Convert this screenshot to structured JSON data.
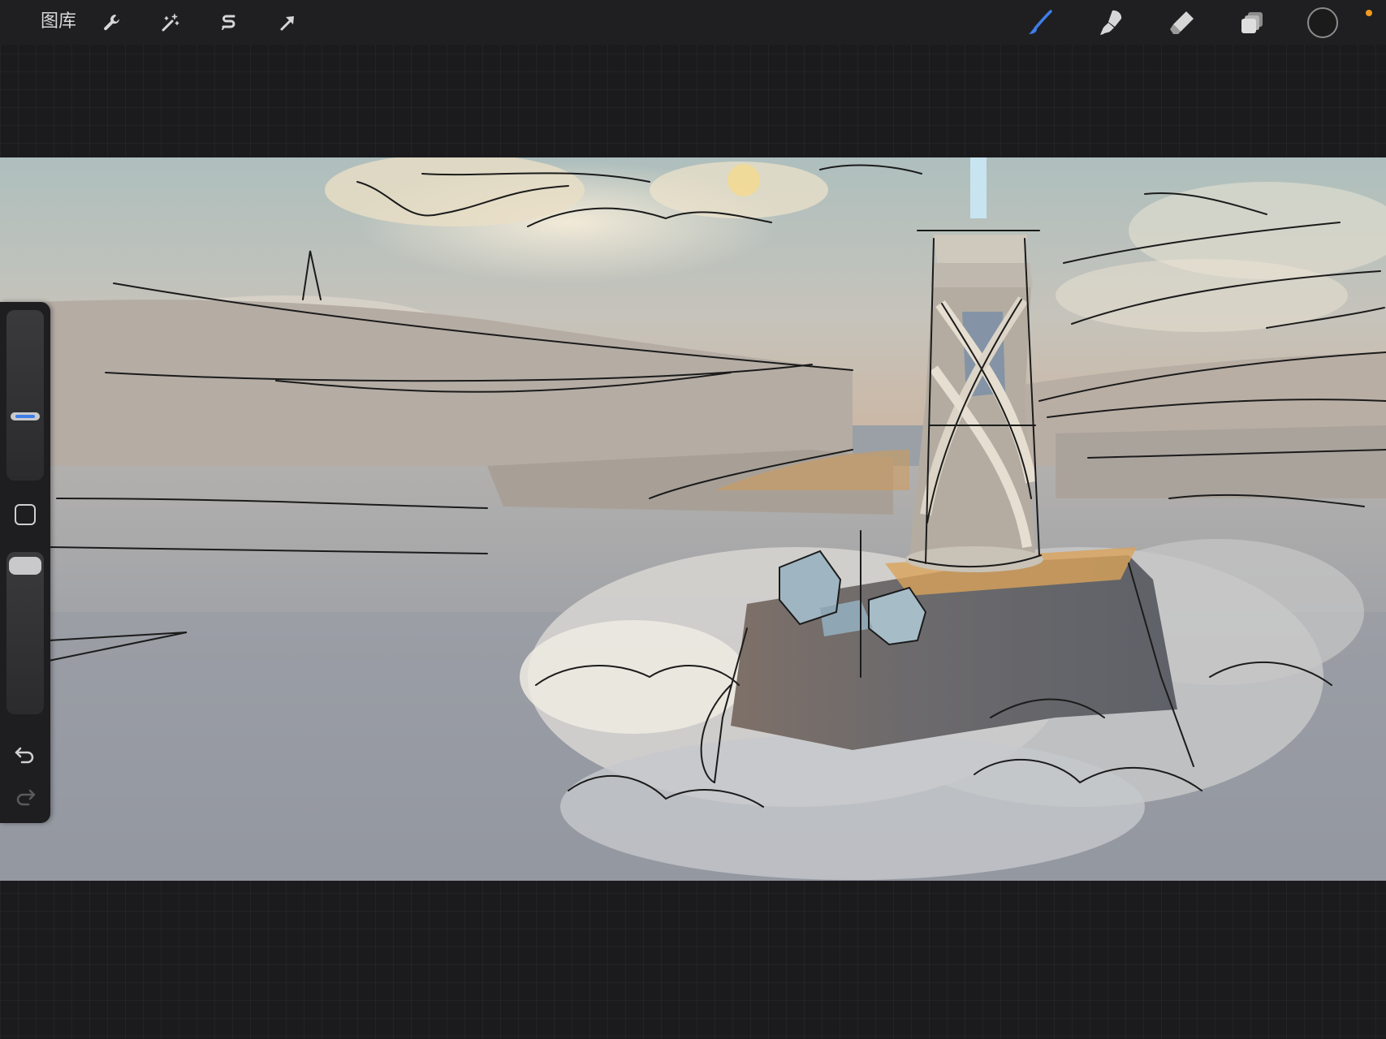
{
  "toolbar": {
    "gallery_label": "图库",
    "left_tools": [
      {
        "name": "actions",
        "icon": "wrench-icon"
      },
      {
        "name": "adjustments",
        "icon": "magic-wand-icon"
      },
      {
        "name": "selection",
        "icon": "selection-s-icon"
      },
      {
        "name": "transform",
        "icon": "arrow-cursor-icon"
      }
    ],
    "right_tools": [
      {
        "name": "brush",
        "icon": "brush-icon",
        "active": true
      },
      {
        "name": "smudge",
        "icon": "smudge-finger-icon",
        "active": false
      },
      {
        "name": "eraser",
        "icon": "eraser-icon",
        "active": false
      },
      {
        "name": "layers",
        "icon": "layers-icon",
        "active": false
      },
      {
        "name": "color",
        "icon": "color-swatch-icon",
        "value": "#1b1b1b"
      }
    ],
    "accent_color": "#3f7ee8",
    "status_dot_color": "#f39a1e"
  },
  "sidebar": {
    "brush_size_level": 0.42,
    "opacity_level": 1.0,
    "modify_button": "square-icon",
    "undo": "undo-icon",
    "redo": "redo-icon",
    "redo_enabled": false
  },
  "canvas": {
    "content": "sketch-painting"
  }
}
